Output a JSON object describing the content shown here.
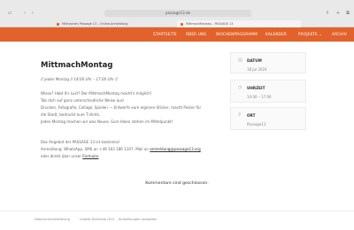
{
  "browser": {
    "url": "passage13.de",
    "tabs": [
      {
        "label": "Mitmachen Passage 13 – Online-Anmeldung"
      },
      {
        "label": "MittmachMontag – PASSAGE 13"
      }
    ]
  },
  "nav": {
    "items": [
      "STARTSEITE",
      "ÜBER UNS",
      "WOCHENPROGRAMM",
      "KALENDER",
      "PROJEKTE ⌄",
      "ARCHIV"
    ]
  },
  "content": {
    "title": "MittmachMontag",
    "schedule": "// jeden Montag // 14:00 Uhr – 17:00 Uhr //",
    "lines": [
      "Wieso? Habt Ihr Lust? Der MittmachMontag macht's möglich!",
      "Tob dich auf ganz unterschiedliche Weise aus!",
      "Drucken, Fotografie, Collage, Spielen — Entwerfe eure eigenen Sticker, macht Poster für",
      "die Stadt, bedruckt eure T-shirts.",
      "Jeden Montag machen wir was Neues. Eure Ideen stehen im Mittelpunkt!"
    ],
    "info1": "Das Angebot der PASSAGE 13 ist kostenlos!",
    "info2_prefix": "Anmeldung: WhatsApp, SMS an +49 163 186 1107, Mail an",
    "email": "anmeldung@passage13.org",
    "info3_prefix": "oder direkt über unser",
    "form_link": "Formular"
  },
  "sidebar": {
    "date_label": "DATUM",
    "date_value": "18 Jul 2024",
    "time_label": "UHRZEIT",
    "time_value": "14:00 – 17:00",
    "place_label": "ORT",
    "place_value": "Passage13"
  },
  "comments_closed": "Kommentare sind geschlossen.",
  "footer": {
    "items": [
      "Datenschutzerklärung",
      "Cookie-Richtlinie (EU)",
      "Einstellungen verwalten"
    ]
  }
}
